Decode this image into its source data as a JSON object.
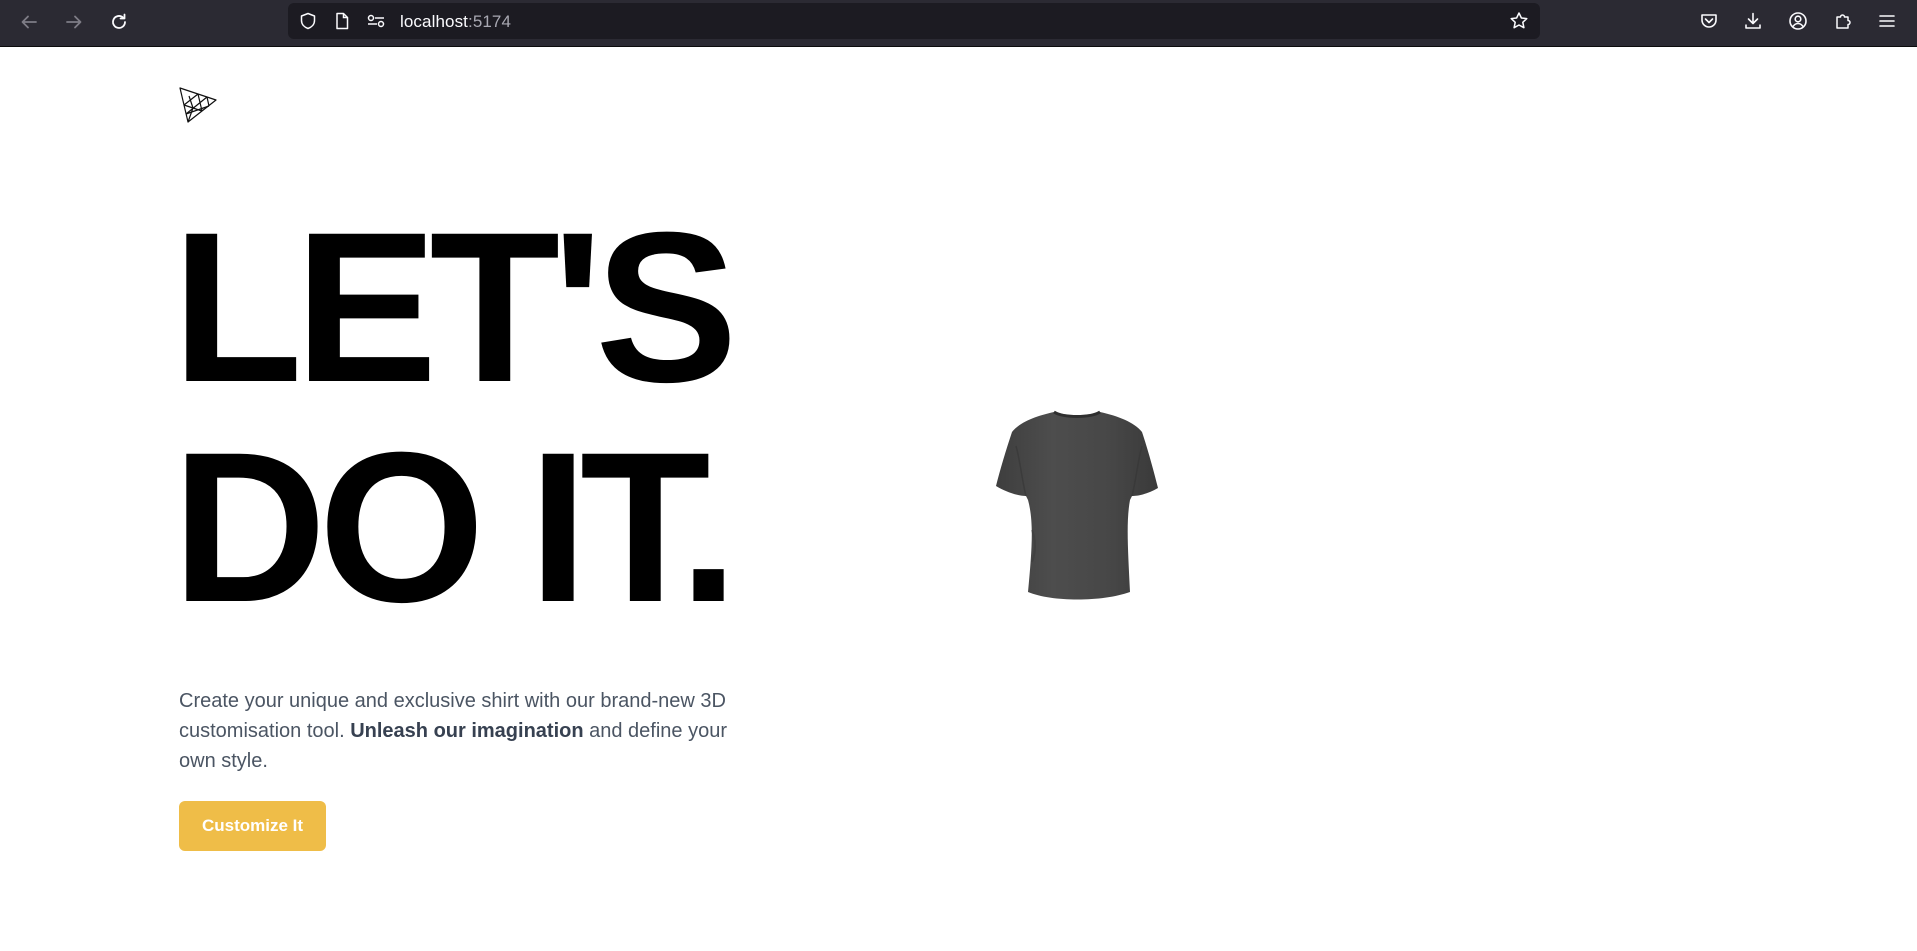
{
  "browser": {
    "url_host": "localhost",
    "url_port": ":5174"
  },
  "hero": {
    "headline_line1": "LET'S",
    "headline_line2": "DO IT.",
    "description_start": "Create your unique and exclusive shirt with our brand-new 3D customisation tool. ",
    "description_bold": "Unleash our imagination",
    "description_end": " and define your own style.",
    "cta_label": "Customize It"
  },
  "colors": {
    "accent": "#EFBD48",
    "shirt": "#4a4a4a",
    "browser_chrome": "#2b2a33"
  },
  "icons": {
    "logo": "threejs-logo-icon",
    "shirt": "tshirt-3d-model"
  }
}
